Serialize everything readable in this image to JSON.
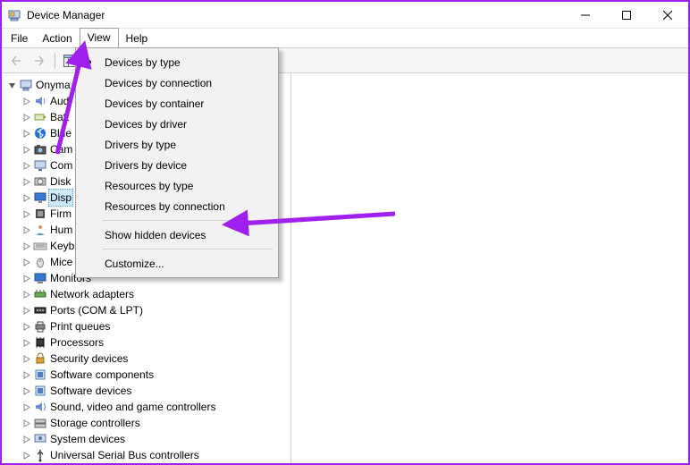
{
  "window": {
    "title": "Device Manager"
  },
  "menubar": {
    "items": [
      "File",
      "Action",
      "View",
      "Help"
    ],
    "open_index": 2
  },
  "tree": {
    "root_label": "Onyma",
    "root_expanded": true,
    "selected_index": 6,
    "children": [
      {
        "label": "Aud",
        "icon": "audio"
      },
      {
        "label": "Batt",
        "icon": "battery"
      },
      {
        "label": "Blue",
        "icon": "bluetooth"
      },
      {
        "label": "Cam",
        "icon": "camera"
      },
      {
        "label": "Com",
        "icon": "computer"
      },
      {
        "label": "Disk",
        "icon": "disk"
      },
      {
        "label": "Disp",
        "icon": "display"
      },
      {
        "label": "Firm",
        "icon": "firmware"
      },
      {
        "label": "Hum",
        "icon": "human"
      },
      {
        "label": "Keyb",
        "icon": "keyboard"
      },
      {
        "label": "Mice",
        "icon": "mouse"
      },
      {
        "label": "Monitors",
        "icon": "monitor"
      },
      {
        "label": "Network adapters",
        "icon": "network"
      },
      {
        "label": "Ports (COM & LPT)",
        "icon": "port"
      },
      {
        "label": "Print queues",
        "icon": "printer"
      },
      {
        "label": "Processors",
        "icon": "cpu"
      },
      {
        "label": "Security devices",
        "icon": "security"
      },
      {
        "label": "Software components",
        "icon": "software"
      },
      {
        "label": "Software devices",
        "icon": "software"
      },
      {
        "label": "Sound, video and game controllers",
        "icon": "sound"
      },
      {
        "label": "Storage controllers",
        "icon": "storage"
      },
      {
        "label": "System devices",
        "icon": "system"
      },
      {
        "label": "Universal Serial Bus controllers",
        "icon": "usb"
      }
    ]
  },
  "view_menu": {
    "sections": [
      {
        "items": [
          {
            "label": "Devices by type",
            "checked": true
          },
          {
            "label": "Devices by connection"
          },
          {
            "label": "Devices by container"
          },
          {
            "label": "Devices by driver"
          },
          {
            "label": "Drivers by type"
          },
          {
            "label": "Drivers by device"
          },
          {
            "label": "Resources by type"
          },
          {
            "label": "Resources by connection"
          }
        ]
      },
      {
        "items": [
          {
            "label": "Show hidden devices"
          }
        ]
      },
      {
        "items": [
          {
            "label": "Customize..."
          }
        ]
      }
    ]
  },
  "annotations": {
    "arrow_color": "#a020f0"
  }
}
